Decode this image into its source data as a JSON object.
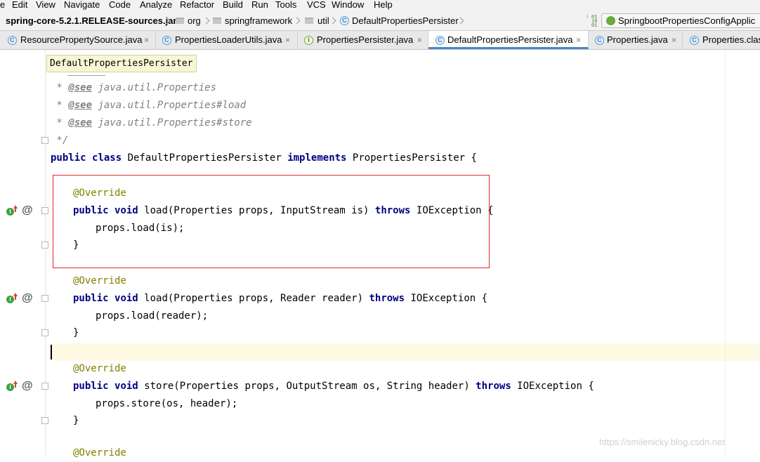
{
  "menu": [
    "e",
    "Edit",
    "View",
    "Navigate",
    "Code",
    "Analyze",
    "Refactor",
    "Build",
    "Run",
    "Tools",
    "VCS",
    "Window",
    "Help"
  ],
  "breadcrumb": {
    "jar": "spring-core-5.2.1.RELEASE-sources.jar",
    "org": "org",
    "springframework": "springframework",
    "util": "util",
    "class": "DefaultPropertiesPersister",
    "run_config": "SpringbootPropertiesConfigApplic"
  },
  "tabs": [
    {
      "label": "ResourcePropertySource.java",
      "icon": "C",
      "close": "×",
      "active": false
    },
    {
      "label": "PropertiesLoaderUtils.java",
      "icon": "C",
      "close": "×",
      "active": false
    },
    {
      "label": "PropertiesPersister.java",
      "icon": "I",
      "close": "×",
      "active": false
    },
    {
      "label": "DefaultPropertiesPersister.java",
      "icon": "C",
      "close": "×",
      "active": true
    },
    {
      "label": "Properties.java",
      "icon": "C",
      "close": "×",
      "active": false
    },
    {
      "label": "Properties.clas",
      "icon": "C",
      "close": "",
      "active": false
    }
  ],
  "tooltip": "DefaultPropertiesPersister",
  "code": {
    "see1": {
      "star": " * ",
      "tag": "@see",
      "rest": " java.util.Properties"
    },
    "see2": {
      "star": " * ",
      "tag": "@see",
      "rest": " java.util.Properties#load"
    },
    "see3": {
      "star": " * ",
      "tag": "@see",
      "rest": " java.util.Properties#store"
    },
    "end_comment": " */",
    "class_decl": {
      "kw1": "public",
      "kw2": "class",
      "name": " DefaultPropertiesPersister ",
      "kw3": "implements",
      "rest": " PropertiesPersister {"
    },
    "override": "@Override",
    "m1": {
      "kw1": "public",
      "kw2": "void",
      "sig": " load(Properties props, InputStream is) ",
      "kw3": "throws",
      "rest": " IOException {"
    },
    "m1_body": "props.load(is);",
    "m2": {
      "kw1": "public",
      "kw2": "void",
      "sig": " load(Properties props, Reader reader) ",
      "kw3": "throws",
      "rest": " IOException {"
    },
    "m2_body": "props.load(reader);",
    "m3": {
      "kw1": "public",
      "kw2": "void",
      "sig": " store(Properties props, OutputStream os, String header) ",
      "kw3": "throws",
      "rest": " IOException {"
    },
    "m3_body": "props.store(os, header);",
    "close_brace": "}"
  },
  "gutter_icons": {
    "implements": "implements-method-icon",
    "override": "override-at-icon",
    "at_glyph": "@",
    "dot_glyph": "I"
  },
  "watermark": "https://smilenicky.blog.csdn.net",
  "colors": {
    "keyword": "#000080",
    "annotation": "#808000",
    "comment": "#808080",
    "highlight_border": "#e0292b",
    "caret_row": "#fffae3"
  }
}
